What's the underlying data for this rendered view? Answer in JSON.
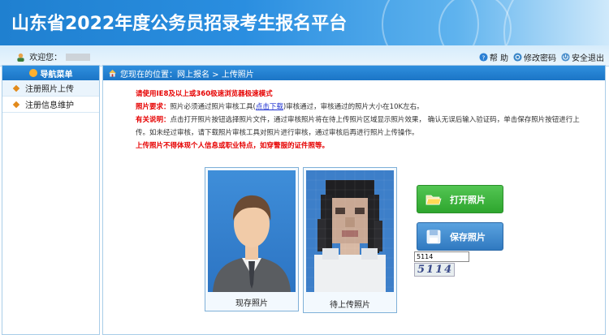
{
  "header": {
    "title": "山东省2022年度公务员招录考生报名平台"
  },
  "toolbar": {
    "welcome": "欢迎您：",
    "help": "帮 助",
    "change_password": "修改密码",
    "logout": "安全退出"
  },
  "sidebar": {
    "title": "导航菜单",
    "items": [
      {
        "label": "注册照片上传"
      },
      {
        "label": "注册信息维护"
      }
    ]
  },
  "breadcrumb": "您现在的位置：网上报名 > 上传照片",
  "notice": {
    "browser_tip": "请使用IE8及以上或360极速浏览器极速模式",
    "photo_req_label": "照片要求：",
    "photo_req_text1": "照片必须通过照片审核工具(",
    "photo_req_link": "点击下载",
    "photo_req_text2": ")审核通过，审核通过的照片大小在10K左右。",
    "explain_label": "有关说明：",
    "explain_text": "点击打开照片按钮选择照片文件，通过审核照片将在待上传照片区域显示照片效果， 确认无误后输入验证码，单击保存照片按钮进行上传。如未经过审核，请下载照片审核工具对照片进行审核，通过审核后再进行照片上传操作。",
    "warning": "上传照片不得体现个人信息或职业特点，如穿警服的证件照等。"
  },
  "photos": {
    "current_caption": "现存照片",
    "upload_caption": "待上传照片"
  },
  "buttons": {
    "open_photo": "打开照片",
    "save_photo": "保存照片"
  },
  "captcha": {
    "input_value": "5114",
    "image_text": "5114"
  },
  "colors": {
    "header_blue": "#1f80d0",
    "nav_blue": "#1b75c6",
    "open_green": "#2ea62e",
    "save_blue": "#3079c0",
    "alert_red": "#e60000"
  }
}
